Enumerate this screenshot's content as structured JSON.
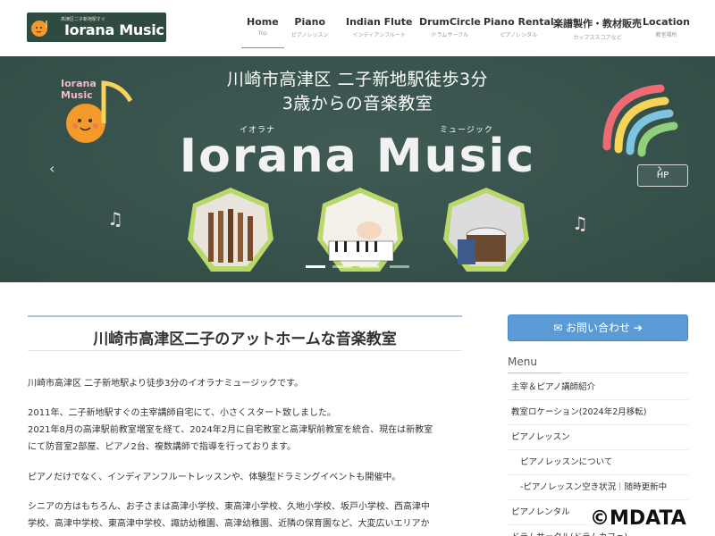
{
  "header": {
    "logo_small": "高津区二子新地駅すぐ",
    "logo_name": "Iorana Music",
    "nav": [
      {
        "label": "Home",
        "sub": "Top"
      },
      {
        "label": "Piano",
        "sub": "ピアノレッスン"
      },
      {
        "label": "Indian Flute",
        "sub": "インディアンフルート"
      },
      {
        "label": "DrumCircle",
        "sub": "ドラムサークル"
      },
      {
        "label": "Piano Rental",
        "sub": "ピアノレンタル"
      },
      {
        "label": "楽譜製作・教材販売",
        "sub": "カップススコアなど"
      },
      {
        "label": "Location",
        "sub": "教室場所"
      }
    ]
  },
  "hero": {
    "line1": "川崎市高津区 二子新地駅徒歩3分",
    "line2": "3歳からの音楽教室",
    "ruby_left": "イオラナ",
    "ruby_right": "ミュージック",
    "title": "Iorana Music",
    "logo_text_1": "Iorana",
    "logo_text_2": "Music",
    "hp_label": "HP",
    "prev_arrow": "‹",
    "next_arrow": "›",
    "slide_count": 4,
    "active_slide": 1
  },
  "main": {
    "title": "川崎市高津区二子のアットホームな音楽教室",
    "p1": "川崎市高津区 二子新地駅より徒歩3分のイオラナミュージックです。",
    "p2a": "2011年、二子新地駅すぐの主宰講師自宅にて、小さくスタート致しました。",
    "p2b": "2021年8月の高津駅前教室増室を経て、2024年2月に自宅教室と高津駅前教室を統合、現在は新教室",
    "p2c": "にて防音室2部屋、ピアノ2台、複数講師で指導を行っております。",
    "p3": "ピアノだけでなく、インディアンフルートレッスンや、体験型ドラミングイベントも開催中。",
    "p4a": "シニアの方はもちろん、お子さまは高津小学校、東高津小学校、久地小学校、坂戸小学校、西高津中",
    "p4b": "学校、高津中学校、東高津中学校、諏訪幼稚園、高津幼稚園、近隣の保育園など、大変広いエリアか"
  },
  "sidebar": {
    "contact_label": "お問い合わせ",
    "menu_heading": "Menu",
    "items": [
      "主宰＆ピアノ講師紹介",
      "教室ロケーション(2024年2月移転)",
      "ピアノレッスン",
      "ピアノレッスンについて",
      "-ピアノレッスン空き状況｜随時更新中",
      "ピアノレンタル",
      "ドラムサークル(ドラムカフェ)"
    ]
  },
  "watermark": "©MDATA",
  "colors": {
    "hero_bg": "#34504a",
    "accent": "#5b9bd5",
    "logo_bg": "#2f4a40"
  }
}
